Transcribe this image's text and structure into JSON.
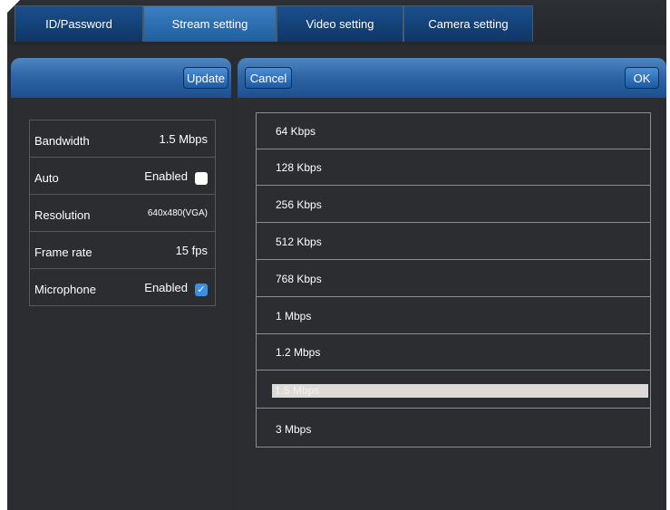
{
  "tabs": [
    {
      "label": "ID/Password"
    },
    {
      "label": "Stream setting",
      "active": true
    },
    {
      "label": "Video setting"
    },
    {
      "label": "Camera setting"
    }
  ],
  "left_panel": {
    "update_label": "Update"
  },
  "right_panel": {
    "cancel_label": "Cancel",
    "ok_label": "OK"
  },
  "settings": {
    "bandwidth": {
      "label": "Bandwidth",
      "value": "1.5 Mbps"
    },
    "auto": {
      "label": "Auto",
      "value": "Enabled",
      "checked": false
    },
    "resolution": {
      "label": "Resolution",
      "value": "640x480(VGA)"
    },
    "frame_rate": {
      "label": "Frame rate",
      "value": "15 fps"
    },
    "microphone": {
      "label": "Microphone",
      "value": "Enabled",
      "checked": true
    }
  },
  "bitrate_options": [
    "64 Kbps",
    "128 Kbps",
    "256 Kbps",
    "512 Kbps",
    "768 Kbps",
    "1 Mbps",
    "1.2 Mbps",
    "1.5 Mbps",
    "3 Mbps"
  ],
  "selected_bitrate": "1.5 Mbps",
  "colors": {
    "tab_active": "#3b7fc2",
    "tab_inactive": "#0e3666",
    "background": "#2a2c30",
    "checkbox_on": "#3d8fe0"
  }
}
